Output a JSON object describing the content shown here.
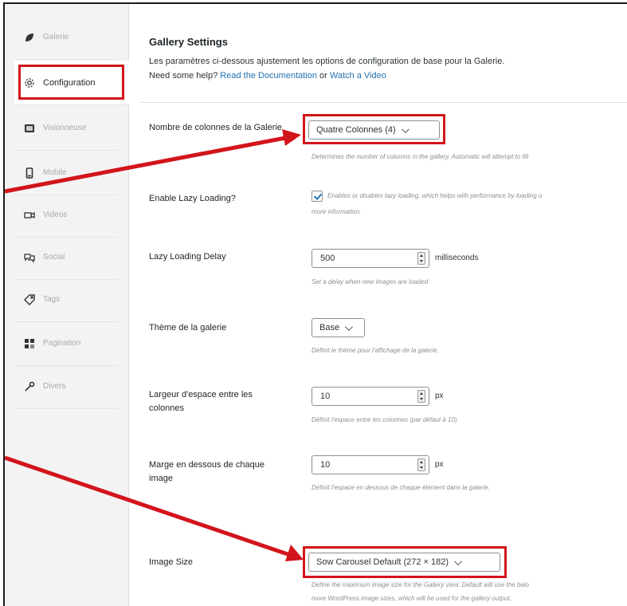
{
  "sidebar": {
    "items": [
      {
        "label": "Galerie",
        "icon": "leaf-icon"
      },
      {
        "label": "Configuration",
        "icon": "gear-icon"
      },
      {
        "label": "Visionneuse",
        "icon": "lightbox-icon"
      },
      {
        "label": "Mobile",
        "icon": "mobile-icon"
      },
      {
        "label": "Videos",
        "icon": "video-icon"
      },
      {
        "label": "Social",
        "icon": "social-icon"
      },
      {
        "label": "Tags",
        "icon": "tag-icon"
      },
      {
        "label": "Pagination",
        "icon": "pagination-icon"
      },
      {
        "label": "Divers",
        "icon": "wrench-icon"
      }
    ],
    "active": "Configuration"
  },
  "header": {
    "title": "Gallery Settings",
    "description": "Les paramètres ci-dessous ajustement les options de configuration de base pour la Galerie.",
    "help_prefix": "Need some help?",
    "doc_link": "Read the Documentation",
    "or_text": "or",
    "video_link": "Watch a Video"
  },
  "settings": {
    "columns": {
      "label": "Nombre de colonnes de la Galerie",
      "value": "Quatre Colonnes (4)",
      "help": "Determines the number of columns in the gallery. Automatic will attempt to fill"
    },
    "lazy": {
      "label": "Enable Lazy Loading?",
      "checked": true,
      "help_line1": "Enables or disables lazy loading, which helps with performance by loading o",
      "help_line2": "more information."
    },
    "lazy_delay": {
      "label": "Lazy Loading Delay",
      "value": "500",
      "unit": "milliseconds",
      "help": "Set a delay when new images are loaded"
    },
    "theme": {
      "label": "Thème de la galerie",
      "value": "Base",
      "help": "Définit le thème pour l'affichage de la galerie."
    },
    "gutter": {
      "label": "Largeur d'espace entre les colonnes",
      "value": "10",
      "unit": "px",
      "help": "Définit l'espace entre les colonnes (par défaut à 10)."
    },
    "margin": {
      "label": "Marge en dessous de chaque image",
      "value": "10",
      "unit": "px",
      "help": "Définit l'espace en dessous de chaque élément dans la galerie."
    },
    "image_size": {
      "label": "Image Size",
      "value": "Sow Carousel Default (272 × 182)",
      "help_line1": "Define the maximum image size for the Gallery view. Default will use the belo",
      "help_line2": "more WordPress image sizes, which will be used for the gallery output."
    }
  },
  "colors": {
    "highlight": "#d2141b",
    "link": "#2271b1"
  }
}
